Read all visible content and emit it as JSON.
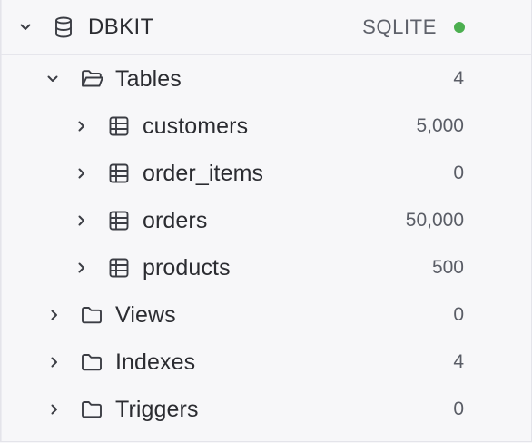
{
  "connection": {
    "name": "DBKIT",
    "type": "SQLITE",
    "status_color": "#4caf50",
    "expanded": true
  },
  "groups": {
    "tables": {
      "label": "Tables",
      "count": "4",
      "expanded": true
    },
    "views": {
      "label": "Views",
      "count": "0",
      "expanded": false
    },
    "indexes": {
      "label": "Indexes",
      "count": "4",
      "expanded": false
    },
    "triggers": {
      "label": "Triggers",
      "count": "0",
      "expanded": false
    }
  },
  "tables": [
    {
      "name": "customers",
      "rows": "5,000"
    },
    {
      "name": "order_items",
      "rows": "0"
    },
    {
      "name": "orders",
      "rows": "50,000"
    },
    {
      "name": "products",
      "rows": "500"
    }
  ],
  "icons": {
    "connection": "database-icon",
    "group_open": "folder-open-icon",
    "group_closed": "folder-icon",
    "table": "table-grid-icon",
    "expand": "chevron-right-icon",
    "collapse": "chevron-down-icon"
  },
  "colors": {
    "background": "#f7f7f9",
    "text": "#2b2c31",
    "muted": "#5a5d66",
    "status_online": "#4caf50"
  }
}
